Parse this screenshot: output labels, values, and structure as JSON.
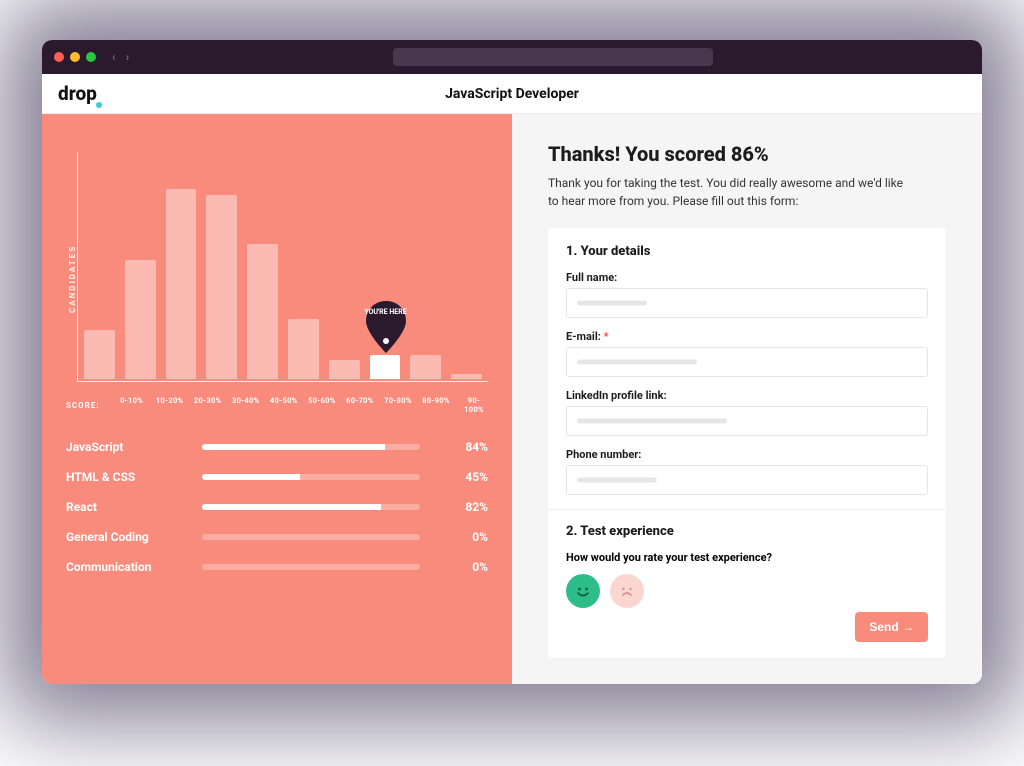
{
  "brand": "drop",
  "page_title": "JavaScript Developer",
  "colors": {
    "accent": "#f88b7c",
    "happy": "#2dbd8b",
    "sad": "#fbd6d1"
  },
  "chart": {
    "y_label": "CANDIDATES",
    "x_label": "SCORE:",
    "labels": [
      "0-10%",
      "10-20%",
      "20-30%",
      "30-40%",
      "40-50%",
      "50-60%",
      "60-70%",
      "70-80%",
      "80-90%",
      "90-100%"
    ],
    "values": [
      45,
      110,
      175,
      170,
      125,
      55,
      18,
      22,
      22,
      5
    ],
    "max": 180,
    "highlight_index": 7,
    "marker_text": "YOU'RE HERE"
  },
  "chart_data": {
    "type": "bar",
    "title": "",
    "xlabel": "SCORE",
    "ylabel": "CANDIDATES",
    "categories": [
      "0-10%",
      "10-20%",
      "20-30%",
      "30-40%",
      "40-50%",
      "50-60%",
      "60-70%",
      "70-80%",
      "80-90%",
      "90-100%"
    ],
    "values": [
      45,
      110,
      175,
      170,
      125,
      55,
      18,
      22,
      22,
      5
    ],
    "ylim": [
      0,
      180
    ],
    "highlight_index": 7,
    "annotation": "YOU'RE HERE"
  },
  "scores": [
    {
      "name": "JavaScript",
      "pct": 84
    },
    {
      "name": "HTML & CSS",
      "pct": 45
    },
    {
      "name": "React",
      "pct": 82
    },
    {
      "name": "General Coding",
      "pct": 0
    },
    {
      "name": "Communication",
      "pct": 0
    }
  ],
  "result": {
    "title": "Thanks! You scored 86%",
    "subtitle": "Thank you for taking the test. You did really awesome and we'd like to hear more from you. Please fill out this form:"
  },
  "form": {
    "section1_title": "1. Your details",
    "fields": {
      "full_name": {
        "label": "Full name:"
      },
      "email": {
        "label": "E-mail:",
        "required": true
      },
      "linkedin": {
        "label": "LinkedIn profile link:"
      },
      "phone": {
        "label": "Phone number:"
      }
    },
    "section2_title": "2. Test experience",
    "question": "How would you rate your test experience?",
    "send_label": "Send →"
  }
}
